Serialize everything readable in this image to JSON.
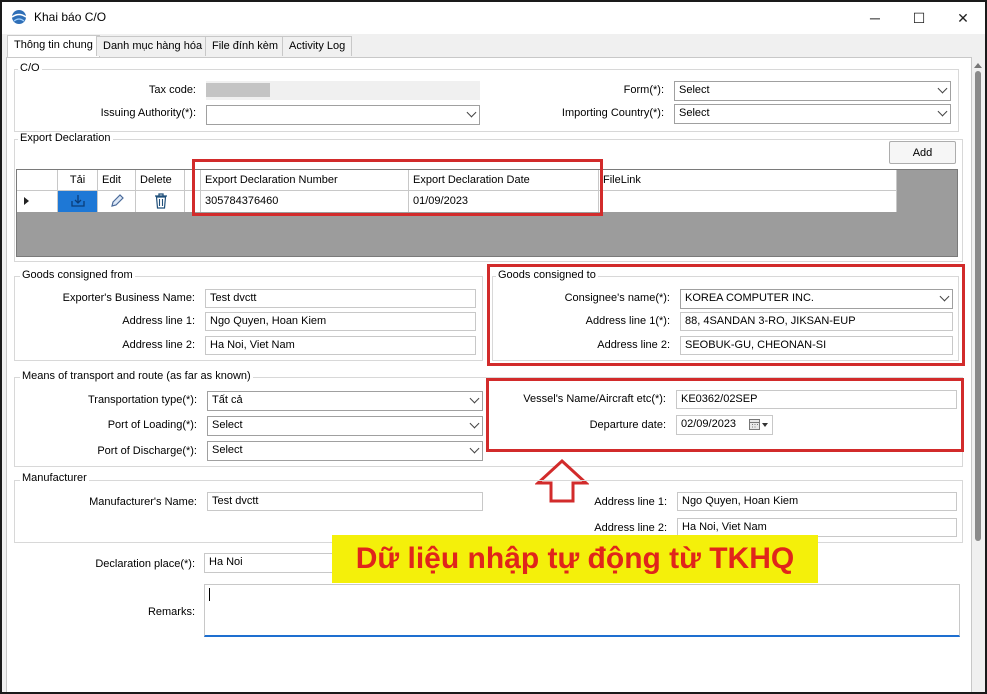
{
  "window": {
    "title": "Khai báo C/O",
    "minimize": "─",
    "maximize": "☐",
    "close": "✕"
  },
  "tabs": [
    "Thông tin chung",
    "Danh mục hàng hóa",
    "File đính kèm",
    "Activity Log"
  ],
  "co": {
    "group_label": "C/O",
    "tax_code_label": "Tax code:",
    "issuing_authority_label": "Issuing Authority(*):",
    "form_label": "Form(*):",
    "form_value": "Select",
    "importing_country_label": "Importing Country(*):",
    "importing_country_value": "Select"
  },
  "export_declaration": {
    "group_label": "Export Declaration",
    "add_button": "Add",
    "columns": [
      "Tải",
      "Edit",
      "Delete",
      "Export Declaration Number",
      "Export Declaration Date",
      "FileLink"
    ],
    "rows": [
      {
        "number": "305784376460",
        "date": "01/09/2023",
        "filelink": ""
      }
    ]
  },
  "goods_from": {
    "group_label": "Goods consigned from",
    "business_name_label": "Exporter's Business Name:",
    "business_name": "Test dvctt",
    "address1_label": "Address line 1:",
    "address1": "Ngo Quyen, Hoan Kiem",
    "address2_label": "Address line 2:",
    "address2": "Ha Noi, Viet Nam"
  },
  "goods_to": {
    "group_label": "Goods consigned to",
    "consignee_label": "Consignee's name(*):",
    "consignee": "KOREA COMPUTER INC.",
    "address1_label": "Address line 1(*):",
    "address1": "88, 4SANDAN 3-RO, JIKSAN-EUP",
    "address2_label": "Address line 2:",
    "address2": "SEOBUK-GU, CHEONAN-SI"
  },
  "transport": {
    "group_label": "Means of transport and route (as far as known)",
    "type_label": "Transportation type(*):",
    "type_value": "Tất cả",
    "loading_label": "Port of Loading(*):",
    "loading_value": "Select",
    "discharge_label": "Port of Discharge(*):",
    "discharge_value": "Select",
    "vessel_label": "Vessel's Name/Aircraft etc(*):",
    "vessel_value": "KE0362/02SEP",
    "departure_label": "Departure date:",
    "departure_value": "02/09/2023"
  },
  "manufacturer": {
    "group_label": "Manufacturer",
    "name_label": "Manufacturer's Name:",
    "name": "Test dvctt",
    "address1_label": "Address line 1:",
    "address1": "Ngo Quyen, Hoan Kiem",
    "address2_label": "Address line 2:",
    "address2": "Ha Noi, Viet Nam"
  },
  "declaration_place_label": "Declaration place(*):",
  "declaration_place": "Ha Noi",
  "remarks_label": "Remarks:",
  "remarks": "",
  "annotation": "Dữ liệu nhập tự động từ TKHQ",
  "colors": {
    "highlight": "#d22b2b",
    "banner_bg": "#f4f00a",
    "banner_text": "#e0251b",
    "selected_cell": "#1e78d6"
  }
}
